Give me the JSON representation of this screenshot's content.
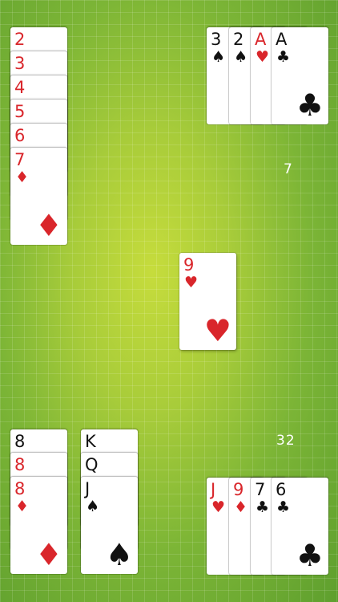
{
  "colors": {
    "red": "#d9262b",
    "black": "#111111",
    "felt": "#8fc238"
  },
  "scores": {
    "top_right": "7",
    "bottom_right": "32"
  },
  "piles": {
    "diamonds": [
      {
        "rank": "2",
        "suit": "♦"
      },
      {
        "rank": "3",
        "suit": "♦"
      },
      {
        "rank": "4",
        "suit": "♦"
      },
      {
        "rank": "5",
        "suit": "♦"
      },
      {
        "rank": "6",
        "suit": "♦"
      },
      {
        "rank": "7",
        "suit": "♦"
      }
    ],
    "top_right_hand": [
      {
        "rank": "3",
        "suit": "♠"
      },
      {
        "rank": "2",
        "suit": "♠"
      },
      {
        "rank": "A",
        "suit": "♥"
      },
      {
        "rank": "A",
        "suit": "♣"
      }
    ],
    "center": {
      "rank": "9",
      "suit": "♥"
    },
    "eights": [
      {
        "rank": "8",
        "suit": "♠"
      },
      {
        "rank": "8",
        "suit": "♥"
      },
      {
        "rank": "8",
        "suit": "♦"
      }
    ],
    "spades": [
      {
        "rank": "K",
        "suit": "♠"
      },
      {
        "rank": "Q",
        "suit": "♠"
      },
      {
        "rank": "J",
        "suit": "♠"
      }
    ],
    "player_hand": [
      {
        "rank": "J",
        "suit": "♥"
      },
      {
        "rank": "9",
        "suit": "♦"
      },
      {
        "rank": "7",
        "suit": "♣"
      },
      {
        "rank": "6",
        "suit": "♣"
      }
    ]
  }
}
